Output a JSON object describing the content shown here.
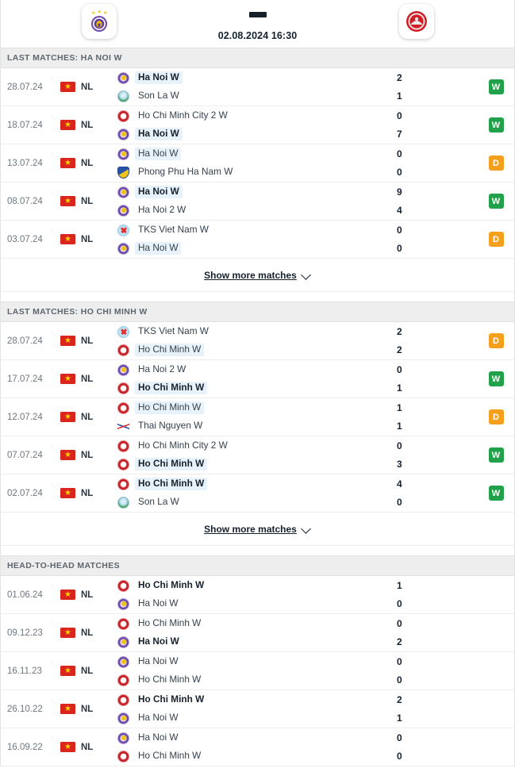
{
  "header": {
    "home_team": "Ha Noi W",
    "away_team": "Ho Chi Minh W",
    "home_crest": "hanoi-crest",
    "away_crest": "hcm-crest",
    "separator": "-",
    "kickoff": "02.08.2024 16:30"
  },
  "show_more_label": "Show more matches",
  "sections": [
    {
      "id": "last-matches-ha-noi-w",
      "title": "LAST MATCHES: HA NOI W",
      "has_show_more": true,
      "matches": [
        {
          "date": "28.07.24",
          "league": "NL",
          "flag": "vietnam-flag",
          "home": {
            "name": "Ha Noi W",
            "crest": "hanoi",
            "bold": true,
            "highlight": true
          },
          "away": {
            "name": "Son La W",
            "crest": "sonla",
            "bold": false,
            "highlight": false
          },
          "home_score": "2",
          "away_score": "1",
          "result": "W"
        },
        {
          "date": "18.07.24",
          "league": "NL",
          "flag": "vietnam-flag",
          "home": {
            "name": "Ho Chi Minh City 2 W",
            "crest": "hcm",
            "bold": false,
            "highlight": false
          },
          "away": {
            "name": "Ha Noi W",
            "crest": "hanoi",
            "bold": true,
            "highlight": true
          },
          "home_score": "0",
          "away_score": "7",
          "result": "W"
        },
        {
          "date": "13.07.24",
          "league": "NL",
          "flag": "vietnam-flag",
          "home": {
            "name": "Ha Noi W",
            "crest": "hanoi",
            "bold": false,
            "highlight": true
          },
          "away": {
            "name": "Phong Phu Ha Nam W",
            "crest": "phhn",
            "bold": false,
            "highlight": false
          },
          "home_score": "0",
          "away_score": "0",
          "result": "D"
        },
        {
          "date": "08.07.24",
          "league": "NL",
          "flag": "vietnam-flag",
          "home": {
            "name": "Ha Noi W",
            "crest": "hanoi",
            "bold": true,
            "highlight": true
          },
          "away": {
            "name": "Ha Noi 2 W",
            "crest": "hanoi",
            "bold": false,
            "highlight": false
          },
          "home_score": "9",
          "away_score": "4",
          "result": "W"
        },
        {
          "date": "03.07.24",
          "league": "NL",
          "flag": "vietnam-flag",
          "home": {
            "name": "TKS Viet Nam W",
            "crest": "tks",
            "bold": false,
            "highlight": false
          },
          "away": {
            "name": "Ha Noi W",
            "crest": "hanoi",
            "bold": false,
            "highlight": true
          },
          "home_score": "0",
          "away_score": "0",
          "result": "D"
        }
      ]
    },
    {
      "id": "last-matches-ho-chi-minh-w",
      "title": "LAST MATCHES: HO CHI MINH W",
      "has_show_more": true,
      "matches": [
        {
          "date": "28.07.24",
          "league": "NL",
          "flag": "vietnam-flag",
          "home": {
            "name": "TKS Viet Nam W",
            "crest": "tks",
            "bold": false,
            "highlight": false
          },
          "away": {
            "name": "Ho Chi Minh W",
            "crest": "hcm",
            "bold": false,
            "highlight": true
          },
          "home_score": "2",
          "away_score": "2",
          "result": "D"
        },
        {
          "date": "17.07.24",
          "league": "NL",
          "flag": "vietnam-flag",
          "home": {
            "name": "Ha Noi 2 W",
            "crest": "hanoi",
            "bold": false,
            "highlight": false
          },
          "away": {
            "name": "Ho Chi Minh W",
            "crest": "hcm",
            "bold": true,
            "highlight": true
          },
          "home_score": "0",
          "away_score": "1",
          "result": "W"
        },
        {
          "date": "12.07.24",
          "league": "NL",
          "flag": "vietnam-flag",
          "home": {
            "name": "Ho Chi Minh W",
            "crest": "hcm",
            "bold": false,
            "highlight": true
          },
          "away": {
            "name": "Thai Nguyen W",
            "crest": "thainguyen",
            "bold": false,
            "highlight": false
          },
          "home_score": "1",
          "away_score": "1",
          "result": "D"
        },
        {
          "date": "07.07.24",
          "league": "NL",
          "flag": "vietnam-flag",
          "home": {
            "name": "Ho Chi Minh City 2 W",
            "crest": "hcm",
            "bold": false,
            "highlight": false
          },
          "away": {
            "name": "Ho Chi Minh W",
            "crest": "hcm",
            "bold": true,
            "highlight": true
          },
          "home_score": "0",
          "away_score": "3",
          "result": "W"
        },
        {
          "date": "02.07.24",
          "league": "NL",
          "flag": "vietnam-flag",
          "home": {
            "name": "Ho Chi Minh W",
            "crest": "hcm",
            "bold": true,
            "highlight": true
          },
          "away": {
            "name": "Son La W",
            "crest": "sonla",
            "bold": false,
            "highlight": false
          },
          "home_score": "4",
          "away_score": "0",
          "result": "W"
        }
      ]
    },
    {
      "id": "head-to-head-matches",
      "title": "HEAD-TO-HEAD MATCHES",
      "has_show_more": false,
      "matches": [
        {
          "date": "01.06.24",
          "league": "NL",
          "flag": "vietnam-flag",
          "home": {
            "name": "Ho Chi Minh W",
            "crest": "hcm",
            "bold": true,
            "highlight": false
          },
          "away": {
            "name": "Ha Noi W",
            "crest": "hanoi",
            "bold": false,
            "highlight": false
          },
          "home_score": "1",
          "away_score": "0",
          "result": ""
        },
        {
          "date": "09.12.23",
          "league": "NL",
          "flag": "vietnam-flag",
          "home": {
            "name": "Ho Chi Minh W",
            "crest": "hcm",
            "bold": false,
            "highlight": false
          },
          "away": {
            "name": "Ha Noi W",
            "crest": "hanoi",
            "bold": true,
            "highlight": false
          },
          "home_score": "0",
          "away_score": "2",
          "result": ""
        },
        {
          "date": "16.11.23",
          "league": "NL",
          "flag": "vietnam-flag",
          "home": {
            "name": "Ha Noi W",
            "crest": "hanoi",
            "bold": false,
            "highlight": false
          },
          "away": {
            "name": "Ho Chi Minh W",
            "crest": "hcm",
            "bold": false,
            "highlight": false
          },
          "home_score": "0",
          "away_score": "0",
          "result": ""
        },
        {
          "date": "26.10.22",
          "league": "NL",
          "flag": "vietnam-flag",
          "home": {
            "name": "Ho Chi Minh W",
            "crest": "hcm",
            "bold": true,
            "highlight": false
          },
          "away": {
            "name": "Ha Noi W",
            "crest": "hanoi",
            "bold": false,
            "highlight": false
          },
          "home_score": "2",
          "away_score": "1",
          "result": ""
        },
        {
          "date": "16.09.22",
          "league": "NL",
          "flag": "vietnam-flag",
          "home": {
            "name": "Ha Noi W",
            "crest": "hanoi",
            "bold": false,
            "highlight": false
          },
          "away": {
            "name": "Ho Chi Minh W",
            "crest": "hcm",
            "bold": false,
            "highlight": false
          },
          "home_score": "0",
          "away_score": "0",
          "result": ""
        }
      ]
    }
  ],
  "colors": {
    "win": "#21a24a",
    "draw": "#f4a01c",
    "section_bg": "#eeeeee",
    "highlight_bg": "#e8f2fb",
    "flag_red": "#da251d",
    "flag_star": "#ffcd00"
  }
}
